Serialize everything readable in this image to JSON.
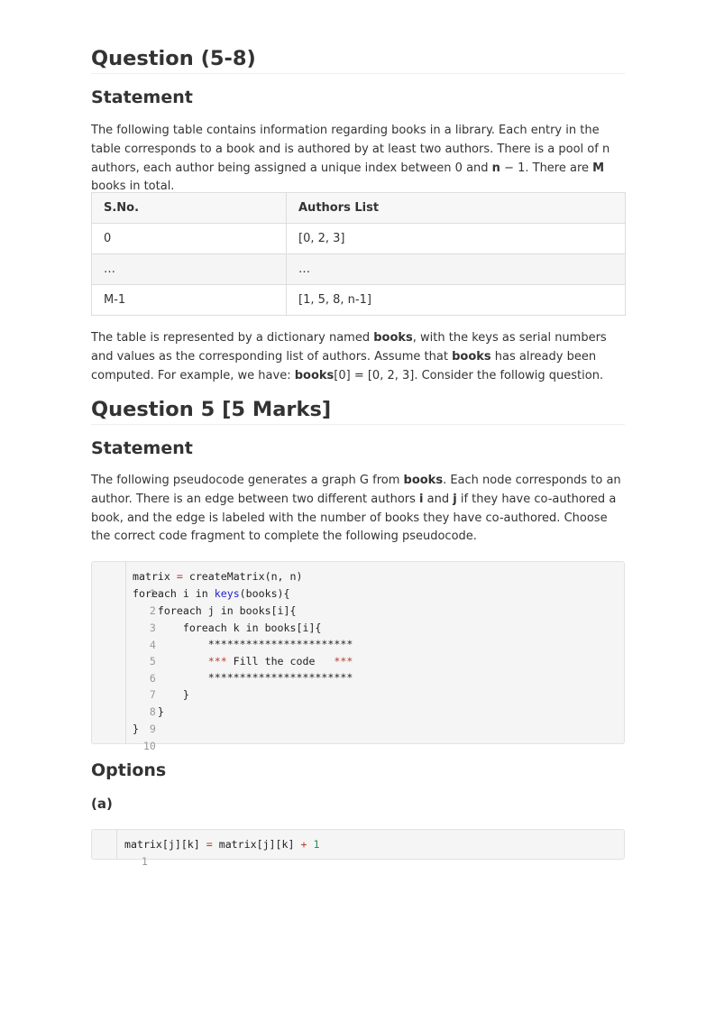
{
  "section1": {
    "title": "Question (5-8)",
    "statement_heading": "Statement",
    "intro": {
      "p1": "The following table contains information regarding books in a library. Each entry in the table corresponds to a book and is authored by at least two authors. There is a pool of n authors, each author being assigned a unique index between 0 and ",
      "b1": "n",
      "p2": " − 1. There are ",
      "b2": "M",
      "p3": " books in total."
    },
    "table": {
      "headers": [
        "S.No.",
        "Authors List"
      ],
      "rows": [
        [
          "0",
          "[0, 2, 3]"
        ],
        [
          "…",
          "…"
        ],
        [
          "M-1",
          "[1, 5, 8, n-1]"
        ]
      ]
    },
    "after_table": {
      "p1": "The table is represented by a dictionary named ",
      "b1": "books",
      "p2": ", with the keys as serial numbers and values as the corresponding list of authors. Assume that ",
      "b2": "books",
      "p3": " has already been computed. For example, we have: ",
      "b3": "books",
      "p4": "[0] = [0, 2, 3]. Consider the followig question."
    }
  },
  "section2": {
    "title": "Question 5 [5 Marks]",
    "statement_heading": "Statement",
    "text": {
      "p1": "The following pseudocode generates a graph G from ",
      "b1": "books",
      "p2": ". Each node corresponds to an author. There is an edge between two different authors ",
      "b2": "i",
      "p3": " and ",
      "b3": "j",
      "p4": " if they have co-authored a book, and the edge is labeled with the number of books they have co-authored. Choose the correct code fragment to complete the following pseudocode."
    },
    "code": {
      "line_numbers": [
        "1",
        "2",
        "3",
        "4",
        "5",
        "6",
        "7",
        "8",
        "9",
        "10"
      ],
      "l1_a": "matrix ",
      "l1_op": "=",
      "l1_b": " createMatrix(n, n)",
      "l2_a": "foreach i in ",
      "l2_kw": "keys",
      "l2_b": "(books){",
      "l3": "    foreach j in books[i]{",
      "l4": "        foreach k in books[i]{",
      "l5": "            ***********************",
      "l6_s1": "            ***",
      "l6_t": " Fill the code   ",
      "l6_s2": "***",
      "l7": "            ***********************",
      "l8": "        }",
      "l9": "    }",
      "l10": "}"
    },
    "options_heading": "Options",
    "option_a": {
      "label": "(a)",
      "line_number": "1",
      "c1": "matrix[j][k] ",
      "op1": "=",
      "c2": " matrix[j][k] ",
      "op2": "+",
      "c3": " ",
      "num": "1"
    }
  }
}
